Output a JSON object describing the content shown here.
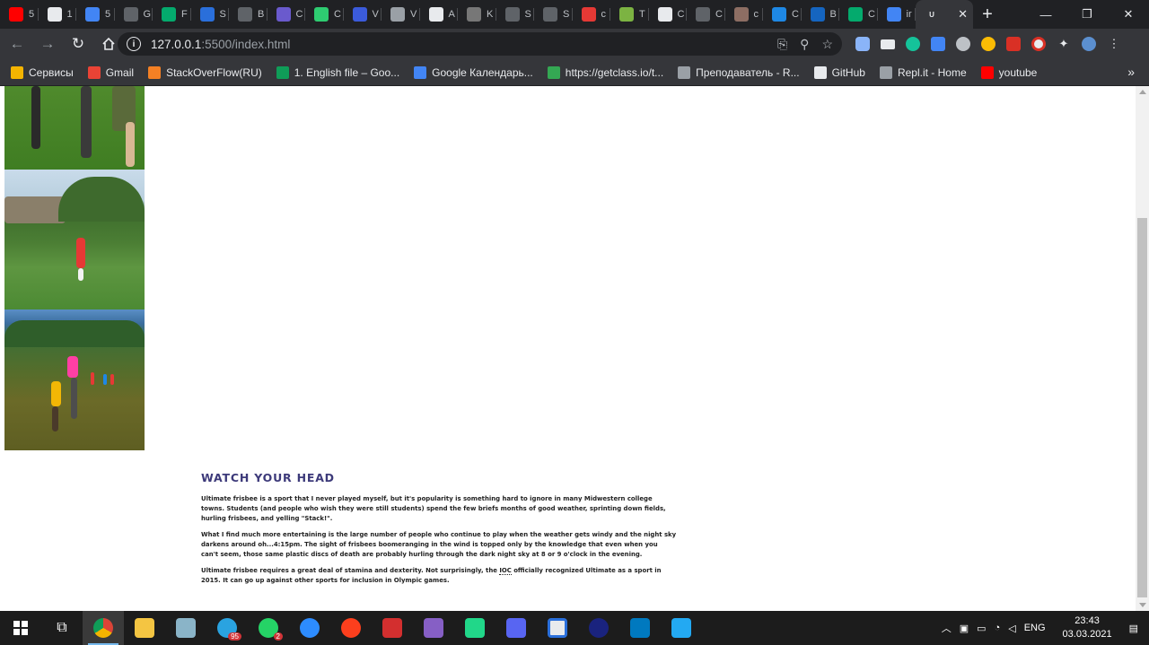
{
  "tabs": [
    {
      "label": "5",
      "icon": "youtube-icon",
      "color": "#ff0000"
    },
    {
      "label": "1",
      "icon": "document-icon",
      "color": "#e8eaed"
    },
    {
      "label": "5",
      "icon": "google-icon",
      "color": "#4285f4"
    },
    {
      "label": "G",
      "icon": "code-icon",
      "color": "#5f6368"
    },
    {
      "label": "F",
      "icon": "w3schools-icon",
      "color": "#04aa6d"
    },
    {
      "label": "S",
      "icon": "stack-icon",
      "color": "#2a6fdb"
    },
    {
      "label": "B",
      "icon": "code-icon",
      "color": "#5f6368"
    },
    {
      "label": "C",
      "icon": "replit-icon",
      "color": "#6a5acd"
    },
    {
      "label": "C",
      "icon": "circle-icon",
      "color": "#2ecc71"
    },
    {
      "label": "V",
      "icon": "w-icon",
      "color": "#3b5bdb"
    },
    {
      "label": "V",
      "icon": "gear-icon",
      "color": "#9aa0a6"
    },
    {
      "label": "A",
      "icon": "codepen-icon",
      "color": "#e8eaed"
    },
    {
      "label": "K",
      "icon": "f-icon",
      "color": "#777777"
    },
    {
      "label": "S",
      "icon": "code-icon",
      "color": "#5f6368"
    },
    {
      "label": "S",
      "icon": "code-icon",
      "color": "#5f6368"
    },
    {
      "label": "c",
      "icon": "asterisk-icon",
      "color": "#e53935"
    },
    {
      "label": "T",
      "icon": "leaf-icon",
      "color": "#7cb342"
    },
    {
      "label": "C",
      "icon": "codepen-icon",
      "color": "#e8eaed"
    },
    {
      "label": "C",
      "icon": "code-icon",
      "color": "#5f6368"
    },
    {
      "label": "c",
      "icon": "avatar-icon",
      "color": "#8d6e63"
    },
    {
      "label": "C",
      "icon": "css-icon",
      "color": "#1e88e5"
    },
    {
      "label": "B",
      "icon": "c-icon",
      "color": "#1565c0"
    },
    {
      "label": "C",
      "icon": "w3schools-icon",
      "color": "#04aa6d"
    },
    {
      "label": "ir",
      "icon": "google-icon",
      "color": "#4285f4"
    }
  ],
  "active_tab": {
    "label": "U",
    "close": "✕"
  },
  "new_tab": "+",
  "window": {
    "minimize": "—",
    "restore": "❐",
    "close": "✕"
  },
  "address": {
    "host": "127.0.0.1",
    "path": ":5500/index.html"
  },
  "bookmarks": [
    {
      "label": "Сервисы",
      "color": "#f4b400"
    },
    {
      "label": "Gmail",
      "color": "#ea4335"
    },
    {
      "label": "StackOverFlow(RU)",
      "color": "#f48024"
    },
    {
      "label": "1. English file – Goo...",
      "color": "#0f9d58"
    },
    {
      "label": "Google Календарь...",
      "color": "#4285f4"
    },
    {
      "label": "https://getclass.io/t...",
      "color": "#34a853"
    },
    {
      "label": "Преподаватель - R...",
      "color": "#9aa0a6"
    },
    {
      "label": "GitHub",
      "color": "#e8eaed"
    },
    {
      "label": "Repl.it - Home",
      "color": "#9aa0a6"
    },
    {
      "label": "youtube",
      "color": "#ff0000"
    }
  ],
  "bookmarks_more": "»",
  "article": {
    "heading": "WATCH YOUR HEAD",
    "p1": "Ultimate frisbee is a sport that I never played myself, but it's popularity is something hard to ignore in many Midwestern college towns. Students (and people who wish they were still students) spend the few briefs months of good weather, sprinting down fields, hurling frisbees, and yelling \"Stack!\".",
    "p2": "What I find much more entertaining is the large number of people who continue to play when the weather gets windy and the night sky darkens around oh...4:15pm. The sight of frisbees boomeranging in the wind is topped only by the knowledge that even when you can't seem, those same plastic discs of death are probably hurling through the dark night sky at 8 or 9 o'clock in the evening.",
    "p3a": "Ultimate frisbee requires a great deal of stamina and dexterity. Not surprisingly, the ",
    "p3abbr": "IOC",
    "p3b": " officially recognized Ultimate as a sport in 2015. It can go up against other sports for inclusion in Olympic games."
  },
  "taskbar_badges": {
    "telegram": "95",
    "whatsapp": "2"
  },
  "tray": {
    "lang": "ENG",
    "time": "23:43",
    "date": "03.03.2021"
  }
}
